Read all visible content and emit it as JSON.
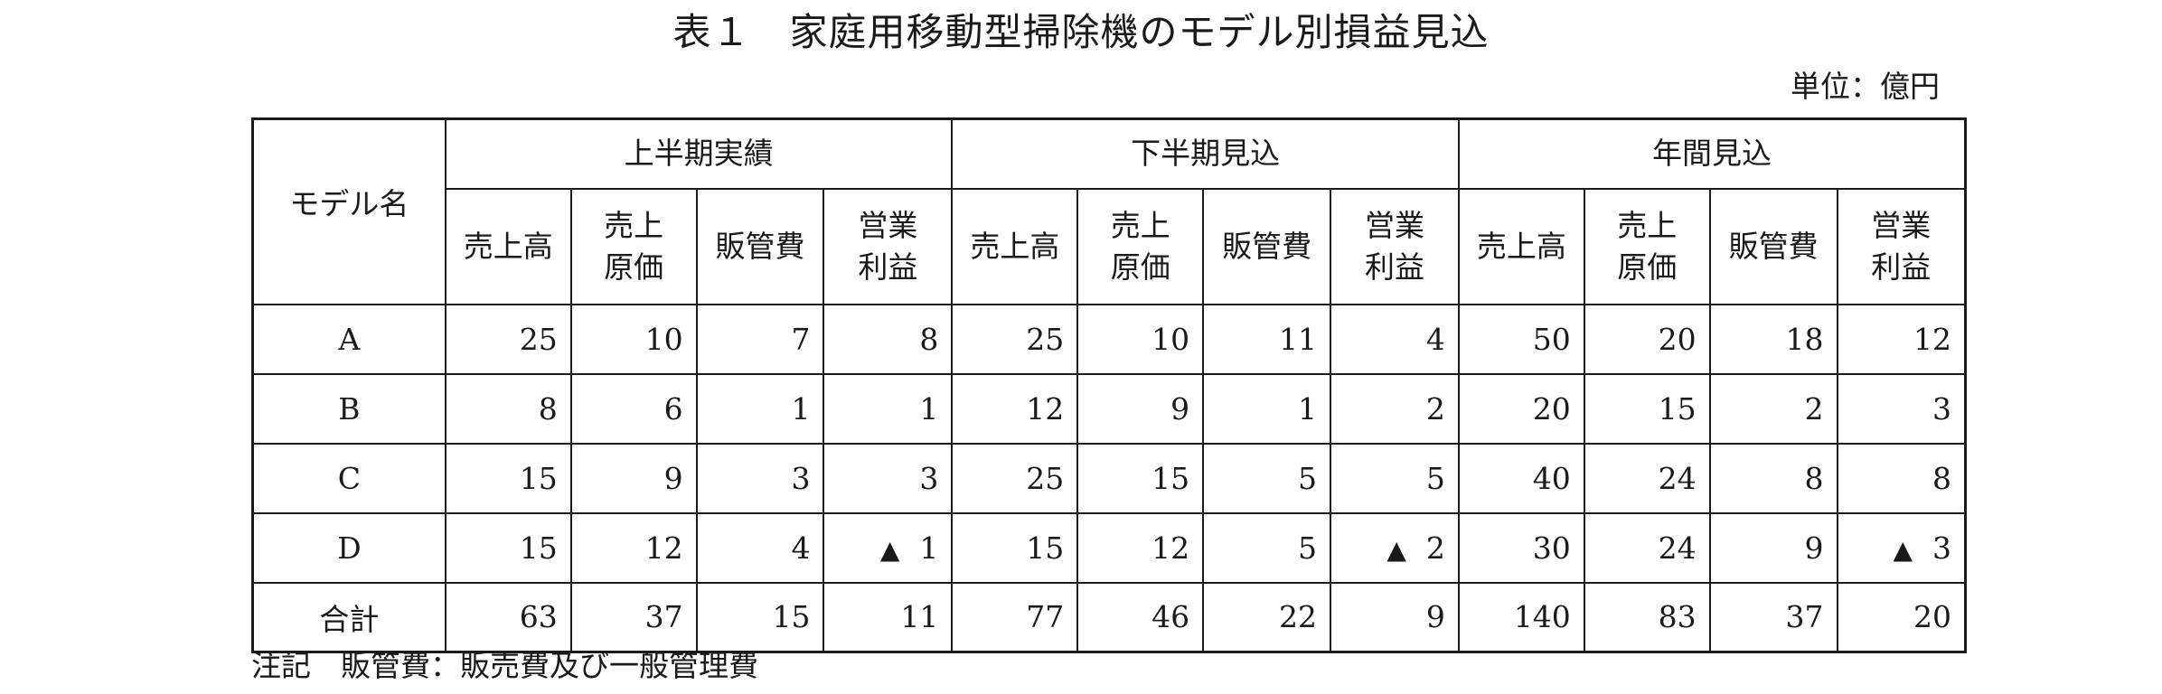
{
  "title": "表１　家庭用移動型掃除機のモデル別損益見込",
  "unit": "単位：億円",
  "table": {
    "model_header": "モデル名",
    "groups": [
      "上半期実績",
      "下半期見込",
      "年間見込"
    ],
    "columns": [
      "売上高",
      "売上\n原価",
      "販管費",
      "営業\n利益"
    ],
    "rows": [
      {
        "name": "A",
        "cells": [
          {
            "v": "25"
          },
          {
            "v": "10"
          },
          {
            "v": "7"
          },
          {
            "v": "8"
          },
          {
            "v": "25"
          },
          {
            "v": "10"
          },
          {
            "v": "11"
          },
          {
            "v": "4"
          },
          {
            "v": "50"
          },
          {
            "v": "20"
          },
          {
            "v": "18"
          },
          {
            "v": "12"
          }
        ]
      },
      {
        "name": "B",
        "cells": [
          {
            "v": "8"
          },
          {
            "v": "6"
          },
          {
            "v": "1"
          },
          {
            "v": "1"
          },
          {
            "v": "12"
          },
          {
            "v": "9"
          },
          {
            "v": "1"
          },
          {
            "v": "2"
          },
          {
            "v": "20"
          },
          {
            "v": "15"
          },
          {
            "v": "2"
          },
          {
            "v": "3"
          }
        ]
      },
      {
        "name": "C",
        "cells": [
          {
            "v": "15"
          },
          {
            "v": "9"
          },
          {
            "v": "3"
          },
          {
            "v": "3"
          },
          {
            "v": "25"
          },
          {
            "v": "15"
          },
          {
            "v": "5"
          },
          {
            "v": "5"
          },
          {
            "v": "40"
          },
          {
            "v": "24"
          },
          {
            "v": "8"
          },
          {
            "v": "8"
          }
        ]
      },
      {
        "name": "D",
        "cells": [
          {
            "v": "15"
          },
          {
            "v": "12"
          },
          {
            "v": "4"
          },
          {
            "neg": "▲",
            "v": "1"
          },
          {
            "v": "15"
          },
          {
            "v": "12"
          },
          {
            "v": "5"
          },
          {
            "neg": "▲",
            "v": "2"
          },
          {
            "v": "30"
          },
          {
            "v": "24"
          },
          {
            "v": "9"
          },
          {
            "neg": "▲",
            "v": "3"
          }
        ]
      },
      {
        "name": "合計",
        "cells": [
          {
            "v": "63"
          },
          {
            "v": "37"
          },
          {
            "v": "15"
          },
          {
            "v": "11"
          },
          {
            "v": "77"
          },
          {
            "v": "46"
          },
          {
            "v": "22"
          },
          {
            "v": "9"
          },
          {
            "v": "140"
          },
          {
            "v": "83"
          },
          {
            "v": "37"
          },
          {
            "v": "20"
          }
        ]
      }
    ]
  },
  "footnote": "注記　販管費：販売費及び一般管理費"
}
